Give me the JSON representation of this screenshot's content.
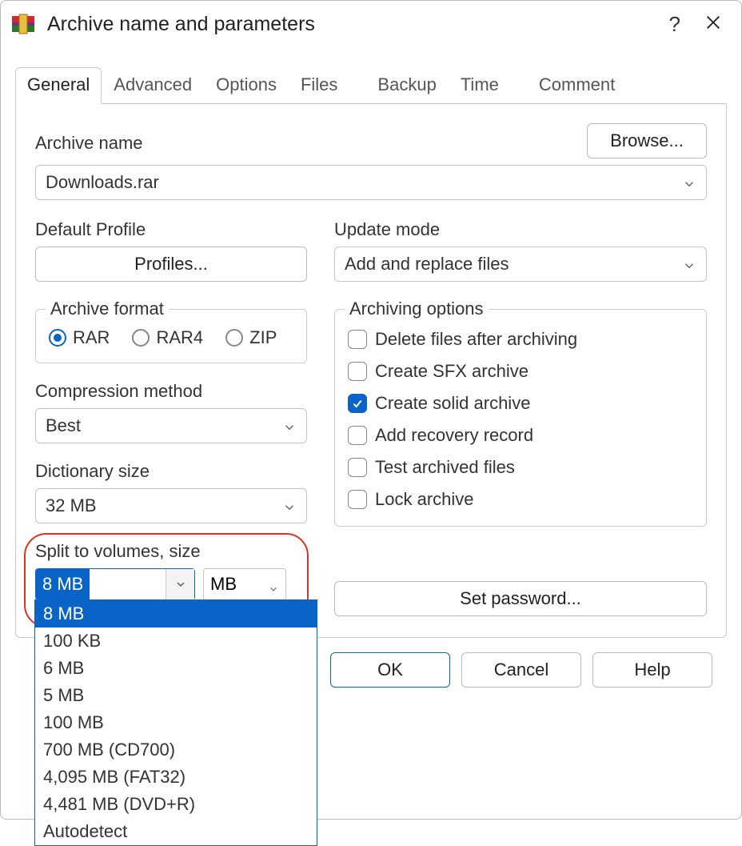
{
  "window": {
    "title": "Archive name and parameters"
  },
  "tabs": [
    "General",
    "Advanced",
    "Options",
    "Files",
    "Backup",
    "Time",
    "Comment"
  ],
  "active_tab": 0,
  "archive_name": {
    "label": "Archive name",
    "value": "Downloads.rar",
    "browse": "Browse..."
  },
  "default_profile": {
    "label": "Default Profile",
    "button": "Profiles..."
  },
  "update_mode": {
    "label": "Update mode",
    "value": "Add and replace files"
  },
  "archive_format": {
    "label": "Archive format",
    "options": [
      "RAR",
      "RAR4",
      "ZIP"
    ],
    "selected": "RAR"
  },
  "compression_method": {
    "label": "Compression method",
    "value": "Best"
  },
  "dictionary_size": {
    "label": "Dictionary size",
    "value": "32 MB"
  },
  "split_volumes": {
    "label": "Split to volumes, size",
    "value": "8 MB",
    "unit": "MB",
    "options": [
      "8 MB",
      "100 KB",
      "6 MB",
      "5 MB",
      "100 MB",
      "700 MB  (CD700)",
      "4,095 MB  (FAT32)",
      "4,481 MB  (DVD+R)",
      "Autodetect"
    ],
    "selected_option_index": 0
  },
  "archiving_options": {
    "label": "Archiving options",
    "items": [
      {
        "label": "Delete files after archiving",
        "checked": false
      },
      {
        "label": "Create SFX archive",
        "checked": false
      },
      {
        "label": "Create solid archive",
        "checked": true
      },
      {
        "label": "Add recovery record",
        "checked": false
      },
      {
        "label": "Test archived files",
        "checked": false
      },
      {
        "label": "Lock archive",
        "checked": false
      }
    ]
  },
  "set_password": "Set password...",
  "footer": {
    "ok": "OK",
    "cancel": "Cancel",
    "help": "Help"
  }
}
